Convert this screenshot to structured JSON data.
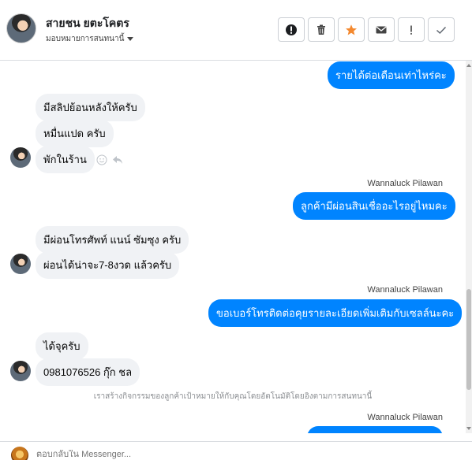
{
  "header": {
    "contact_name": "สายชน ยตะโคตร",
    "assign_label": "มอบหมายการสนทนานี้",
    "toolbar": [
      "spam-icon",
      "trash-icon",
      "star-icon",
      "mail-icon",
      "exclamation-icon",
      "check-icon"
    ]
  },
  "messages": {
    "out1": "รายได้ต่อเดือนเท่าไหร่คะ",
    "in1": "มีสลิปย้อนหลังให้ครับ",
    "in2": "หมื่นแปด ครับ",
    "in3": "พักในร้าน",
    "sender1": "Wannaluck Pilawan",
    "out2": "ลูกค้ามีผ่อนสินเชื่ออะไรอยู่ไหมคะ",
    "in4": "มีผ่อนโทรศัพท์ แนน์ ซัมซุง ครับ",
    "in5": "ผ่อนได้น่าจะ7-8งวด แล้วครับ",
    "sender2": "Wannaluck Pilawan",
    "out3": "ขอเบอร์โทรติดต่อคุยรายละเอียดเพิ่มเติมกับเซลล์นะคะ",
    "in6": "ได้จุครับ",
    "in7": "0981076526 กุ๊ก ชล",
    "system": "เราสร้างกิจกรรมของลูกค้าเป้าหมายให้กับคุณโดยอัตโนมัติโดยอิงตามการสนทนานี้",
    "sender3": "Wannaluck Pilawan"
  },
  "composer": {
    "placeholder": "ตอบกลับใน Messenger..."
  },
  "colors": {
    "outgoing": "#0084ff",
    "incoming": "#f0f2f5",
    "star": "#f4892f"
  }
}
